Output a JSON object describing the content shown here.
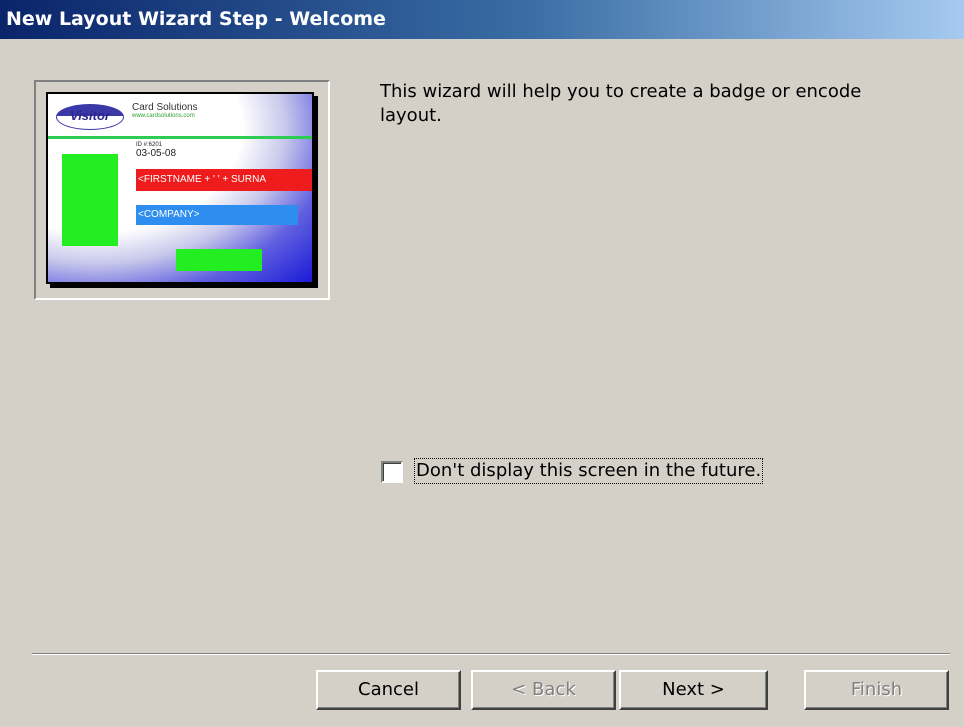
{
  "window": {
    "title": "New Layout Wizard Step - Welcome"
  },
  "preview": {
    "logo_text": "Visitor",
    "company_name": "Card Solutions",
    "company_url": "www.cardsolutions.com",
    "small_label": "ID #:6201",
    "date": "03-05-08",
    "name_field": "<FIRSTNAME + ' ' + SURNA",
    "company_field": "<COMPANY>"
  },
  "main": {
    "intro_text": "This wizard will help you to create a badge or encode layout.",
    "checkbox_label": "Don't display this screen in the future.",
    "checkbox_checked": false
  },
  "buttons": {
    "cancel": "Cancel",
    "back": "< Back",
    "next": "Next >",
    "finish": "Finish"
  }
}
